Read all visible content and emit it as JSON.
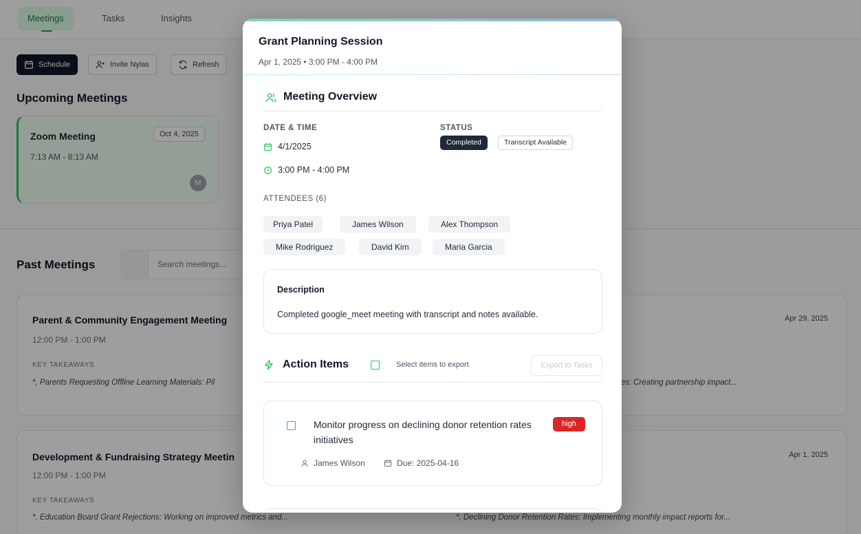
{
  "nav": {
    "tabs": [
      "Meetings",
      "Tasks",
      "Insights"
    ],
    "active": "Meetings"
  },
  "toolbar": {
    "schedule": "Schedule",
    "invite": "Invite Nylas",
    "refresh": "Refresh"
  },
  "upcoming": {
    "heading": "Upcoming Meetings",
    "card": {
      "title": "Zoom Meeting",
      "time": "7:13 AM - 8:13 AM",
      "date": "Oct 4, 2025",
      "avatar": "M"
    }
  },
  "past": {
    "heading": "Past Meetings",
    "search_placeholder": "Search meetings...",
    "key_takeaways_label": "KEY TAKEAWAYS",
    "cards": [
      {
        "title": "Parent & Community Engagement Meeting",
        "time": "12:00 PM - 1:00 PM",
        "takeaway_left": "*, Parents Requesting Offline Learning Materials: Pil",
        "takeaway_right": "ruggles: Creating partnership impact...",
        "date": "Apr 29, 2025"
      },
      {
        "title": "Development & Fundraising Strategy Meetin",
        "time": "12:00 PM - 1:00 PM",
        "takeaway_left": "*, Education Board Grant Rejections: Working on improved metrics and...",
        "takeaway_right": "*, Declining Donor Retention Rates: Implementing monthly impact reports for...",
        "date": "Apr 1, 2025"
      }
    ]
  },
  "modal": {
    "title": "Grant Planning Session",
    "subtitle": "Apr 1, 2025 • 3:00 PM - 4:00 PM",
    "overview": {
      "heading": "Meeting Overview",
      "date_time_label": "DATE & TIME",
      "date": "4/1/2025",
      "time": "3:00 PM - 4:00 PM",
      "status_label": "STATUS",
      "status": "Completed",
      "transcript": "Transcript Available",
      "attendees_label": "ATTENDEES (6)",
      "attendees": [
        "Priya Patel",
        "James Wilson",
        "Alex Thompson",
        "Mike Rodriguez",
        "David Kim",
        "Maria Garcia"
      ]
    },
    "description": {
      "heading": "Description",
      "text": "Completed google_meet meeting with transcript and notes available."
    },
    "action_items": {
      "heading": "Action Items",
      "select_note": "Select items to export",
      "export_button": "Export to Tasks",
      "items": [
        {
          "title": "Monitor progress on declining donor retention rates initiatives",
          "priority": "high",
          "assignee": "James Wilson",
          "due": "Due: 2025-04-16"
        }
      ]
    }
  },
  "colors": {
    "accent": "#22c55e",
    "priority_high": "#dc2626",
    "dark": "#1f2937"
  }
}
